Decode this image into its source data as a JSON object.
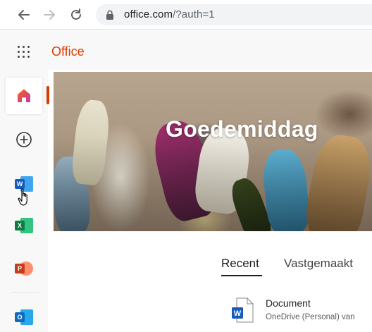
{
  "browser": {
    "back_icon": "arrow-left-icon",
    "forward_icon": "arrow-right-icon",
    "reload_icon": "reload-icon",
    "lock_icon": "lock-icon",
    "url_host": "office.com",
    "url_path": "/?auth=1"
  },
  "header": {
    "waffle_icon": "app-launcher-icon",
    "brand": "Office"
  },
  "rail": {
    "items": [
      {
        "name": "home",
        "icon": "home-icon",
        "active": true
      },
      {
        "name": "create",
        "icon": "plus-circle-icon"
      },
      {
        "name": "word",
        "icon": "word-icon",
        "letter": "W",
        "color": "#185abd"
      },
      {
        "name": "excel",
        "icon": "excel-icon",
        "letter": "X",
        "color": "#107c41"
      },
      {
        "name": "powerpoint",
        "icon": "powerpoint-icon",
        "letter": "P",
        "color": "#c43e1c"
      },
      {
        "name": "outlook",
        "icon": "outlook-icon",
        "letter": "O",
        "color": "#0f6cbd"
      }
    ],
    "accent_color": "#d83b01"
  },
  "hero": {
    "greeting": "Goedemiddag"
  },
  "tabs": [
    {
      "label": "Recent",
      "selected": true
    },
    {
      "label": "Vastgemaakt",
      "selected": false
    }
  ],
  "documents": [
    {
      "name": "Document",
      "location": "OneDrive (Personal) van",
      "icon": "word-document-icon"
    }
  ]
}
